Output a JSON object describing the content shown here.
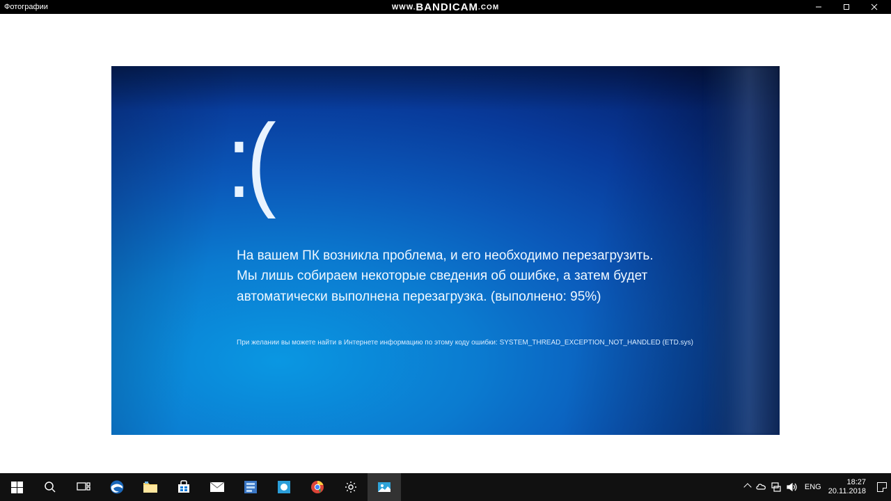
{
  "titlebar": {
    "title": "Фотографии",
    "watermark_prefix": "WWW.",
    "watermark_main": "BANDICAM",
    "watermark_suffix": ".COM"
  },
  "bsod": {
    "sad": ":(",
    "message": "На вашем ПК возникла проблема, и его необходимо перезагрузить. Мы лишь собираем некоторые сведения об ошибке, а затем будет автоматически выполнена перезагрузка. (выполнено: 95%)",
    "detail": "При желании вы можете найти в Интернете информацию по этому коду ошибки: SYSTEM_THREAD_EXCEPTION_NOT_HANDLED (ETD.sys)"
  },
  "tray": {
    "lang": "ENG",
    "time": "18:27",
    "date": "20.11.2018"
  }
}
